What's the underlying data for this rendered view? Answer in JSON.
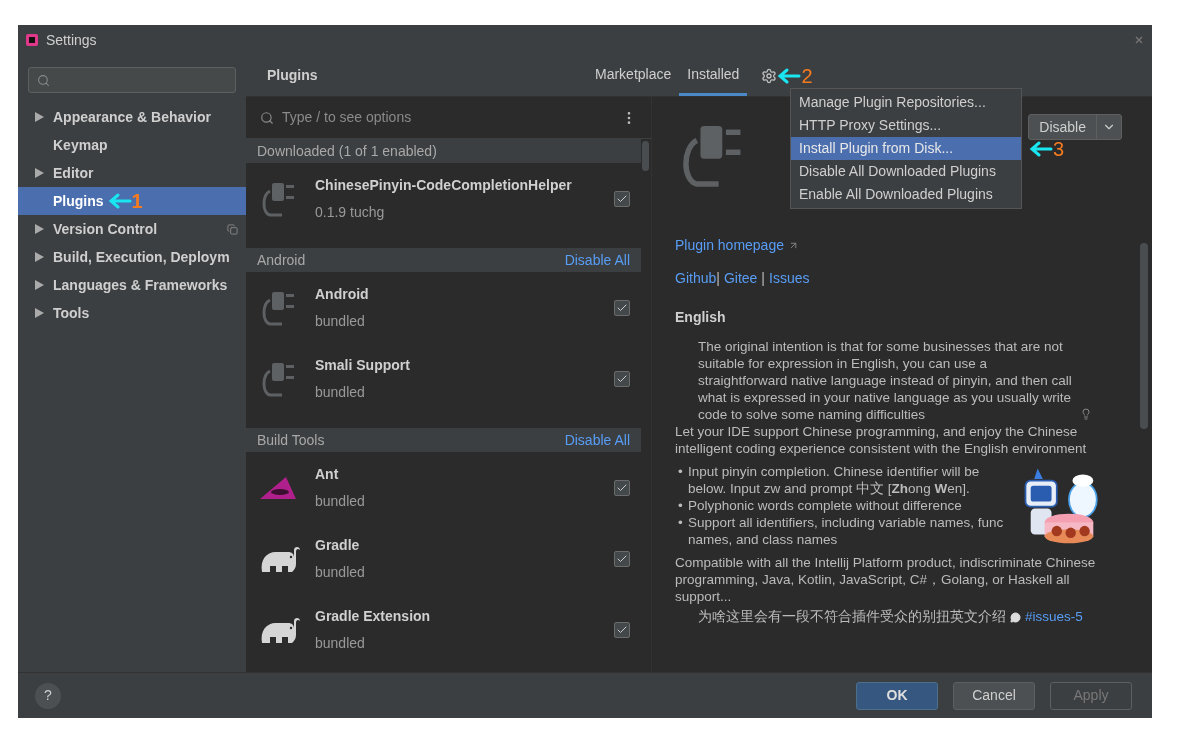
{
  "window": {
    "title": "Settings"
  },
  "sidebar": {
    "items": [
      {
        "label": "Appearance & Behavior",
        "expandable": true,
        "selected": false,
        "badge": false
      },
      {
        "label": "Keymap",
        "expandable": false,
        "selected": false,
        "badge": false
      },
      {
        "label": "Editor",
        "expandable": true,
        "selected": false,
        "badge": false
      },
      {
        "label": "Plugins",
        "expandable": false,
        "selected": true,
        "badge": false,
        "annotation": "1"
      },
      {
        "label": "Version Control",
        "expandable": true,
        "selected": false,
        "badge": true
      },
      {
        "label": "Build, Execution, Deploym",
        "expandable": true,
        "selected": false,
        "badge": false
      },
      {
        "label": "Languages & Frameworks",
        "expandable": true,
        "selected": false,
        "badge": false
      },
      {
        "label": "Tools",
        "expandable": true,
        "selected": false,
        "badge": false
      }
    ]
  },
  "header": {
    "title": "Plugins",
    "tabs": [
      {
        "label": "Marketplace",
        "selected": false
      },
      {
        "label": "Installed",
        "selected": true
      }
    ],
    "gear_annotation": "2"
  },
  "settings_menu": {
    "items": [
      {
        "label": "Manage Plugin Repositories...",
        "selected": false
      },
      {
        "label": "HTTP Proxy Settings...",
        "selected": false
      },
      {
        "label": "Install Plugin from Disk...",
        "selected": true,
        "annotation": "3"
      },
      {
        "label": "Disable All Downloaded Plugins",
        "selected": false
      },
      {
        "label": "Enable All Downloaded Plugins",
        "selected": false
      }
    ]
  },
  "plugin_list": {
    "search": {
      "placeholder": "Type / to see options"
    },
    "groups": [
      {
        "title": "Downloaded (1 of 1 enabled)",
        "plugins": [
          {
            "name": "ChinesePinyin-CodeCompletionHelper",
            "detail": "0.1.9  tuchg",
            "checked": true,
            "kind": "plug"
          }
        ]
      },
      {
        "title": "Android",
        "action": "Disable All",
        "plugins": [
          {
            "name": "Android",
            "detail": "bundled",
            "checked": true,
            "kind": "plug"
          },
          {
            "name": "Smali Support",
            "detail": "bundled",
            "checked": true,
            "kind": "plug"
          }
        ]
      },
      {
        "title": "Build Tools",
        "action": "Disable All",
        "plugins": [
          {
            "name": "Ant",
            "detail": "bundled",
            "checked": true,
            "kind": "ant"
          },
          {
            "name": "Gradle",
            "detail": "bundled",
            "checked": true,
            "kind": "elephant"
          },
          {
            "name": "Gradle Extension",
            "detail": "bundled",
            "checked": true,
            "kind": "elephant"
          }
        ]
      }
    ]
  },
  "detail": {
    "disable_button": "Disable",
    "homepage_link": "Plugin homepage",
    "links": [
      "Github",
      "Gitee",
      "Issues"
    ],
    "link_separator": "|",
    "heading": "English",
    "intro": "The original intention is that for some businesses that are not suitable for expression in English, you can use a straightforward native language instead of pinyin, and then call what is expressed in your native language as you usually write code to solve some naming difficulties",
    "paragraph": "Let your IDE support Chinese programming, and enjoy the Chinese intelligent coding experience consistent with the English environment",
    "bullet": "•",
    "bullets": [
      {
        "lines": [
          "Input pinyin completion. Chinese identifier will be",
          "below. Input zw and prompt 中文 [**Zh**ong **W**en]."
        ]
      },
      {
        "lines": [
          "Polyphonic words complete without difference"
        ]
      },
      {
        "lines": [
          "Support all identifiers, including variable names, func",
          "names, and class names"
        ]
      }
    ],
    "compat": "Compatible with all the Intellij Platform product, indiscriminate Chinese programming, Java, Kotlin, JavaScript, C#，Golang, or Haskell all support...",
    "note": "为啥这里会有一段不符合插件受众的别扭英文介绍",
    "note_link": "#issues-5"
  },
  "footer": {
    "help": "?",
    "buttons": [
      {
        "label": "OK",
        "kind": "primary",
        "disabled": false
      },
      {
        "label": "Cancel",
        "kind": "normal",
        "disabled": false
      },
      {
        "label": "Apply",
        "kind": "normal",
        "disabled": true
      }
    ]
  }
}
